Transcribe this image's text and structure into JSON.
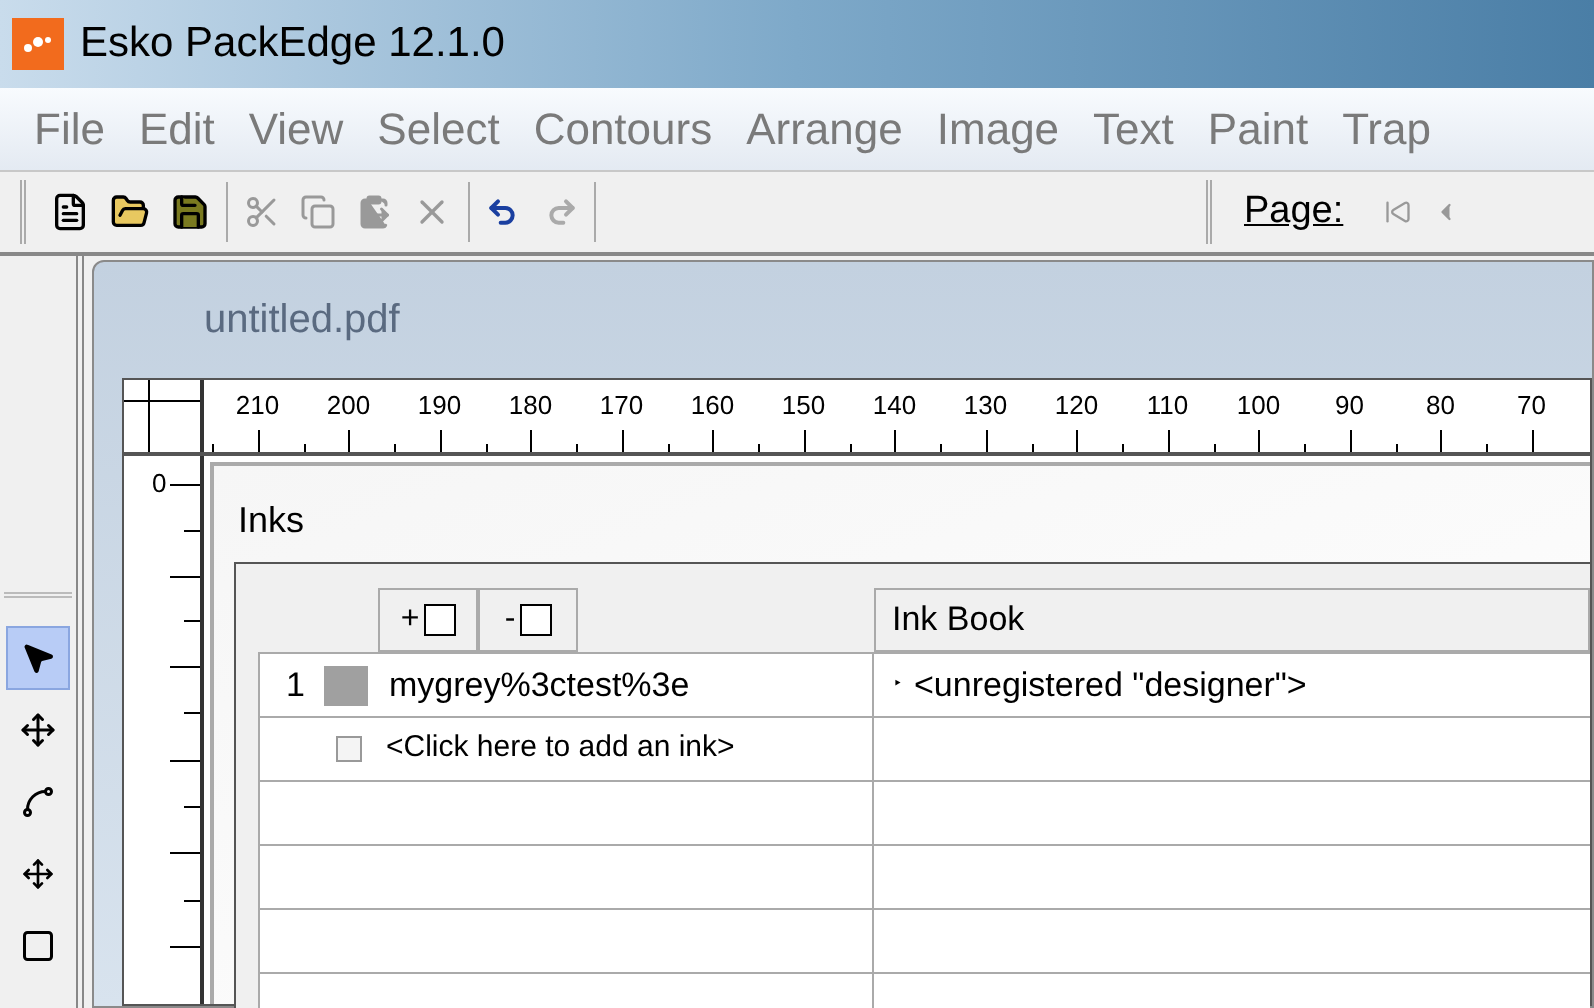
{
  "window": {
    "title": "Esko PackEdge 12.1.0"
  },
  "menu": [
    "File",
    "Edit",
    "View",
    "Select",
    "Contours",
    "Arrange",
    "Image",
    "Text",
    "Paint",
    "Trap"
  ],
  "page_label": "Page:",
  "tools": [
    {
      "kind": "arrow",
      "selected": true
    },
    {
      "kind": "move",
      "selected": false
    },
    {
      "kind": "path",
      "selected": false
    },
    {
      "kind": "transform",
      "selected": false
    },
    {
      "kind": "rect",
      "selected": false
    }
  ],
  "document": {
    "title": "untitled.pdf",
    "ruler_labels": [
      "210",
      "200",
      "190",
      "180",
      "170",
      "160",
      "150",
      "140",
      "130",
      "120",
      "110",
      "100",
      "90",
      "80",
      "70"
    ],
    "vertical_ruler_label": "0"
  },
  "inks_panel": {
    "title": "Inks",
    "add_button": "+",
    "remove_button": "-",
    "columns": [
      "Ink Book"
    ],
    "rows": [
      {
        "number": "1",
        "name": "mygrey%3ctest%3e",
        "color": "#a0a0a0",
        "ink_book_marker": "‣",
        "ink_book": "<unregistered \"designer\">"
      }
    ],
    "add_row": {
      "text": "<Click here to add an ink>",
      "checked": false
    }
  }
}
